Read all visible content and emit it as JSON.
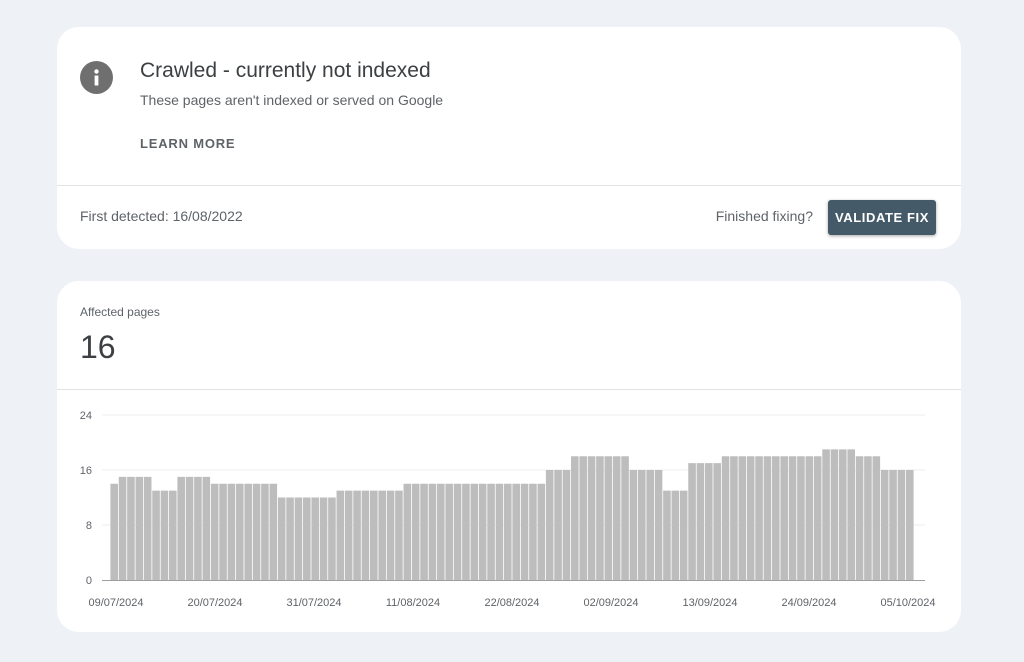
{
  "issue": {
    "title": "Crawled - currently not indexed",
    "subtitle": "These pages aren't indexed or served on Google",
    "learn_more": "LEARN MORE",
    "first_detected": "First detected: 16/08/2022",
    "finished_fixing": "Finished fixing?",
    "validate_fix": "VALIDATE FIX",
    "icon": "info-icon"
  },
  "metric": {
    "label": "Affected pages",
    "value": "16"
  },
  "chart_data": {
    "type": "bar",
    "y_ticks": [
      "0",
      "8",
      "16",
      "24"
    ],
    "ylim": [
      0,
      24
    ],
    "x_tick_labels": [
      "09/07/2024",
      "20/07/2024",
      "31/07/2024",
      "11/08/2024",
      "22/08/2024",
      "02/09/2024",
      "13/09/2024",
      "24/09/2024",
      "05/10/2024"
    ],
    "start_date": "09/07/2024",
    "end_date": "05/10/2024",
    "values": [
      14,
      15,
      15,
      15,
      15,
      13,
      13,
      13,
      15,
      15,
      15,
      15,
      14,
      14,
      14,
      14,
      14,
      14,
      14,
      14,
      12,
      12,
      12,
      12,
      12,
      12,
      12,
      13,
      13,
      13,
      13,
      13,
      13,
      13,
      13,
      14,
      14,
      14,
      14,
      14,
      14,
      14,
      14,
      14,
      14,
      14,
      14,
      14,
      14,
      14,
      14,
      14,
      16,
      16,
      16,
      18,
      18,
      18,
      18,
      18,
      18,
      18,
      16,
      16,
      16,
      16,
      13,
      13,
      13,
      17,
      17,
      17,
      17,
      18,
      18,
      18,
      18,
      18,
      18,
      18,
      18,
      18,
      18,
      18,
      18,
      19,
      19,
      19,
      19,
      18,
      18,
      18,
      16,
      16,
      16,
      16
    ],
    "bar_color": "#bdbdbd",
    "grid": true
  },
  "colors": {
    "background": "#eef2f7",
    "button": "#455a68",
    "bar": "#bdbdbd"
  }
}
